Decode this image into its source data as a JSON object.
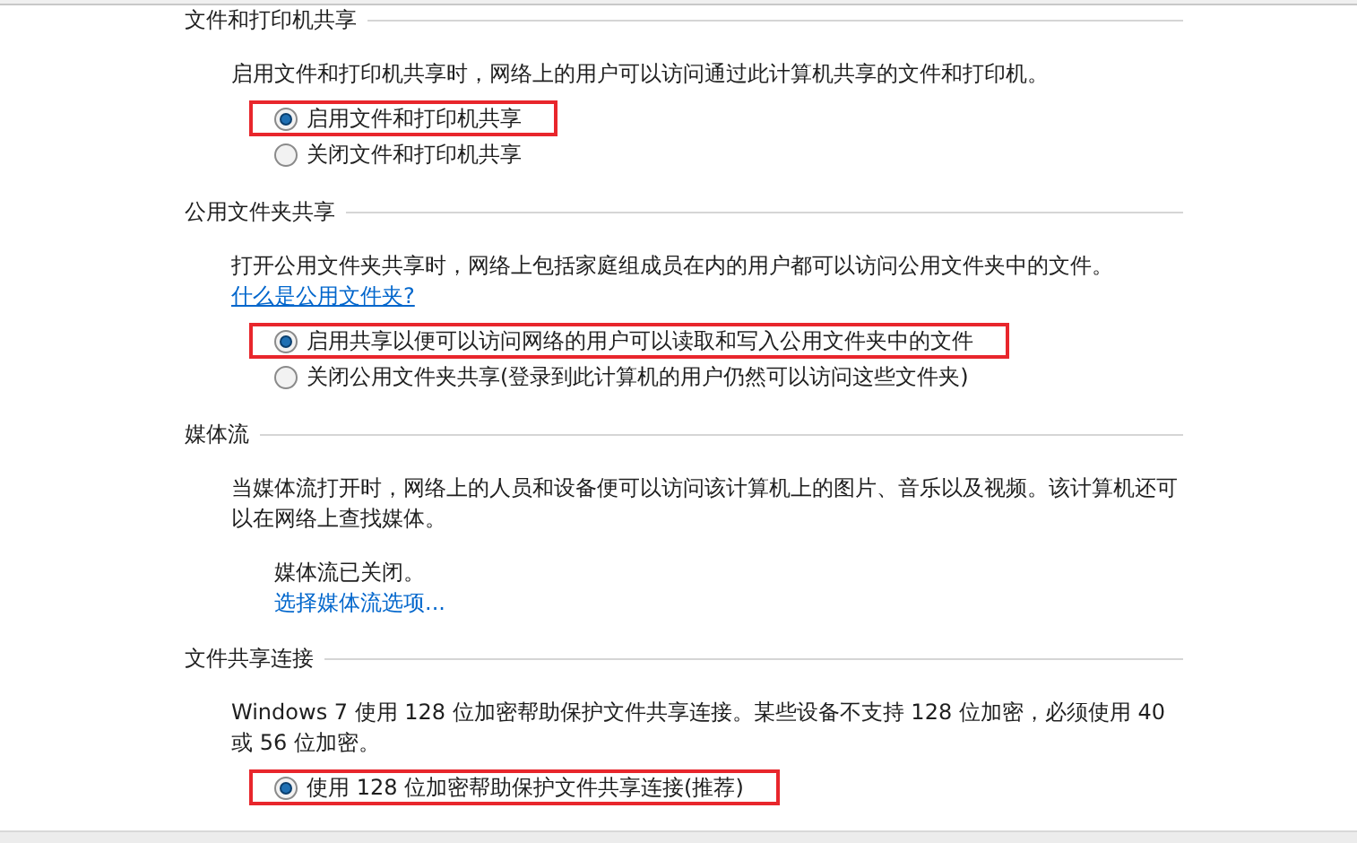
{
  "sections": [
    {
      "heading": "文件和打印机共享",
      "description": "启用文件和打印机共享时，网络上的用户可以访问通过此计算机共享的文件和打印机。",
      "options": [
        {
          "label": "启用文件和打印机共享",
          "selected": true,
          "highlighted": true
        },
        {
          "label": "关闭文件和打印机共享",
          "selected": false,
          "highlighted": false
        }
      ]
    },
    {
      "heading": "公用文件夹共享",
      "description": "打开公用文件夹共享时，网络上包括家庭组成员在内的用户都可以访问公用文件夹中的文件。",
      "description_link": "什么是公用文件夹?",
      "options": [
        {
          "label": "启用共享以便可以访问网络的用户可以读取和写入公用文件夹中的文件",
          "selected": true,
          "highlighted": true
        },
        {
          "label": "关闭公用文件夹共享(登录到此计算机的用户仍然可以访问这些文件夹)",
          "selected": false,
          "highlighted": false
        }
      ]
    },
    {
      "heading": "媒体流",
      "description": "当媒体流打开时，网络上的人员和设备便可以访问该计算机上的图片、音乐以及视频。该计算机还可以在网络上查找媒体。",
      "status": "媒体流已关闭。",
      "status_link": "选择媒体流选项..."
    },
    {
      "heading": "文件共享连接",
      "description": "Windows 7 使用 128 位加密帮助保护文件共享连接。某些设备不支持 128 位加密，必须使用 40 或 56 位加密。",
      "options": [
        {
          "label": "使用 128 位加密帮助保护文件共享连接(推荐)",
          "selected": true,
          "highlighted": true
        }
      ]
    }
  ]
}
